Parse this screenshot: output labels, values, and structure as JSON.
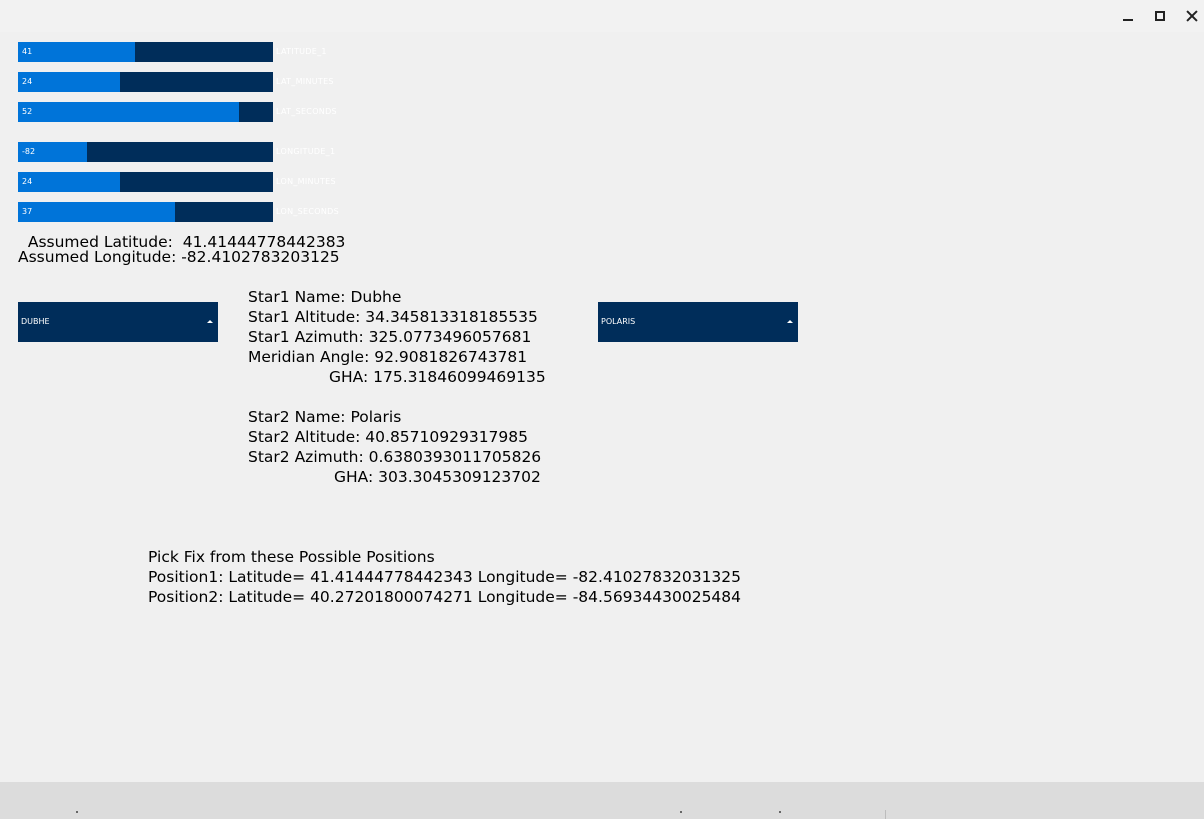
{
  "window": {
    "minimize_label": "",
    "maximize_label": "",
    "close_label": ""
  },
  "sliders": [
    {
      "id": "latitude_1",
      "label": "LATITUDE_1",
      "value": "41",
      "fill": 0.459
    },
    {
      "id": "lat_minutes",
      "label": "LAT_MINUTES",
      "value": "24",
      "fill": 0.4
    },
    {
      "id": "lat_seconds",
      "label": "LAT_SECONDS",
      "value": "52",
      "fill": 0.867
    },
    {
      "id": "longitude_1",
      "label": "LONGITUDE_1",
      "value": "-82",
      "fill": 0.271
    },
    {
      "id": "lon_minutes",
      "label": "LON_MINUTES",
      "value": "24",
      "fill": 0.4
    },
    {
      "id": "lon_seconds",
      "label": "LON_SECONDS",
      "value": "37",
      "fill": 0.616
    }
  ],
  "assumed": {
    "latitude": "  Assumed Latitude:  41.41444778442383",
    "longitude": "Assumed Longitude: -82.4102783203125"
  },
  "dropdowns": {
    "star1": {
      "selected": "DUBHE"
    },
    "star2": {
      "selected": "POLARIS"
    }
  },
  "star1": {
    "name": "Star1 Name: Dubhe",
    "altitude": "Star1 Altitude: 34.345813318185535",
    "azimuth": "Star1 Azimuth: 325.0773496057681",
    "meridian_angle": "Meridian Angle: 92.9081826743781",
    "gha": "GHA: 175.31846099469135"
  },
  "star2": {
    "name": "Star2 Name: Polaris",
    "altitude": "Star2 Altitude: 40.85710929317985",
    "azimuth": "Star2 Azimuth: 0.6380393011705826",
    "gha": "GHA: 303.3045309123702"
  },
  "fix": {
    "heading": "Pick Fix from these Possible Positions",
    "position1": "Position1: Latitude= 41.41444778442343 Longitude= -82.41027832031325",
    "position2": "Position2: Latitude= 40.27201800074271 Longitude= -84.56934430025484"
  },
  "colors": {
    "slider_track": "#002d5a",
    "slider_fill": "#0074d9",
    "dropdown_bg": "#002d5a",
    "background": "#f0f0f0"
  }
}
